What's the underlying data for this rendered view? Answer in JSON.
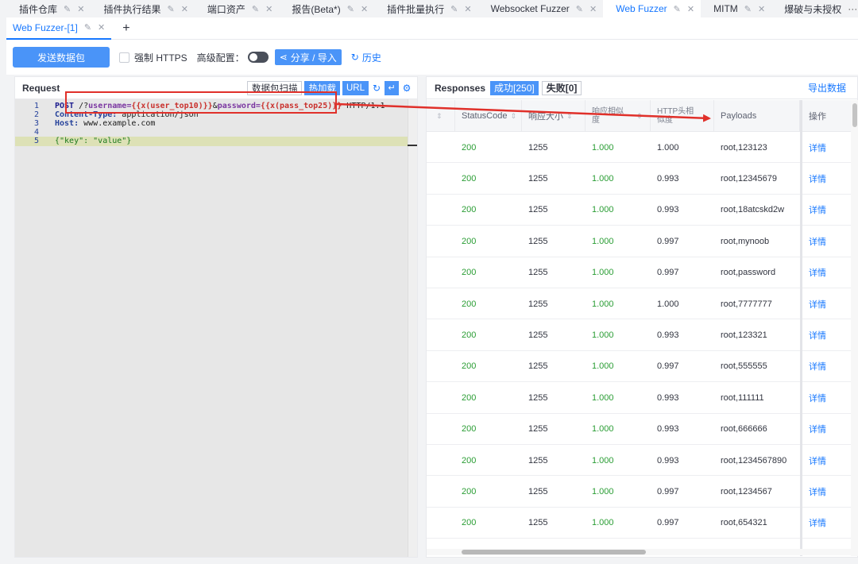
{
  "top_tabs": [
    {
      "label": "插件仓库"
    },
    {
      "label": "插件执行结果"
    },
    {
      "label": "端口资产"
    },
    {
      "label": "报告(Beta*)"
    },
    {
      "label": "插件批量执行"
    },
    {
      "label": "Websocket Fuzzer"
    },
    {
      "label": "Web Fuzzer",
      "active": true
    },
    {
      "label": "MITM"
    },
    {
      "label": "爆破与未授权"
    }
  ],
  "top_more": "···",
  "sub_tab": {
    "label": "Web Fuzzer-[1]",
    "add": "+"
  },
  "toolbar": {
    "send_label": "发送数据包",
    "force_https_label": "强制 HTTPS",
    "advanced_label": "高级配置：",
    "share_label": "分享 / 导入",
    "history_label": "历史"
  },
  "request": {
    "title": "Request",
    "scan_label": "数据包扫描",
    "hotload_label": "热加载",
    "url_label": "URL",
    "line_numbers": [
      "1",
      "2",
      "3",
      "4",
      "5"
    ],
    "line1": {
      "method": "POST",
      "path1": " /?",
      "p1": "username=",
      "t1": "{{x(user_top10)}}",
      "amp": "&",
      "p2": "password=",
      "t2": "{{x(pass_top25)}}",
      "ver": " HTTP/1.1"
    },
    "line2": {
      "key": "Content-Type:",
      "val": " application/json"
    },
    "line3": {
      "key": "Host:",
      "val": " www.example.com"
    },
    "line5": {
      "text": "{\"key\": \"value\"}"
    }
  },
  "responses": {
    "title": "Responses",
    "success_label": "成功[250]",
    "fail_label": "失败[0]",
    "export_label": "导出数据",
    "columns": [
      "StatusCode",
      "响应大小",
      "响应相似度",
      "HTTP头相似度",
      "Payloads",
      "操作"
    ],
    "rows": [
      {
        "status": "200",
        "size": "1255",
        "sim": "1.000",
        "hsim": "1.000",
        "payload": "root,123123",
        "op": "详情"
      },
      {
        "status": "200",
        "size": "1255",
        "sim": "1.000",
        "hsim": "0.993",
        "payload": "root,12345679",
        "op": "详情"
      },
      {
        "status": "200",
        "size": "1255",
        "sim": "1.000",
        "hsim": "0.993",
        "payload": "root,18atcskd2w",
        "op": "详情"
      },
      {
        "status": "200",
        "size": "1255",
        "sim": "1.000",
        "hsim": "0.997",
        "payload": "root,mynoob",
        "op": "详情"
      },
      {
        "status": "200",
        "size": "1255",
        "sim": "1.000",
        "hsim": "0.997",
        "payload": "root,password",
        "op": "详情"
      },
      {
        "status": "200",
        "size": "1255",
        "sim": "1.000",
        "hsim": "1.000",
        "payload": "root,7777777",
        "op": "详情"
      },
      {
        "status": "200",
        "size": "1255",
        "sim": "1.000",
        "hsim": "0.993",
        "payload": "root,123321",
        "op": "详情"
      },
      {
        "status": "200",
        "size": "1255",
        "sim": "1.000",
        "hsim": "0.997",
        "payload": "root,555555",
        "op": "详情"
      },
      {
        "status": "200",
        "size": "1255",
        "sim": "1.000",
        "hsim": "0.993",
        "payload": "root,111111",
        "op": "详情"
      },
      {
        "status": "200",
        "size": "1255",
        "sim": "1.000",
        "hsim": "0.993",
        "payload": "root,666666",
        "op": "详情"
      },
      {
        "status": "200",
        "size": "1255",
        "sim": "1.000",
        "hsim": "0.993",
        "payload": "root,1234567890",
        "op": "详情"
      },
      {
        "status": "200",
        "size": "1255",
        "sim": "1.000",
        "hsim": "0.997",
        "payload": "root,1234567",
        "op": "详情"
      },
      {
        "status": "200",
        "size": "1255",
        "sim": "1.000",
        "hsim": "0.997",
        "payload": "root,654321",
        "op": "详情"
      }
    ]
  },
  "colors": {
    "accent": "#1677ff",
    "button": "#4a94f8",
    "success": "#2a9d34",
    "annotation": "#e0302a"
  }
}
